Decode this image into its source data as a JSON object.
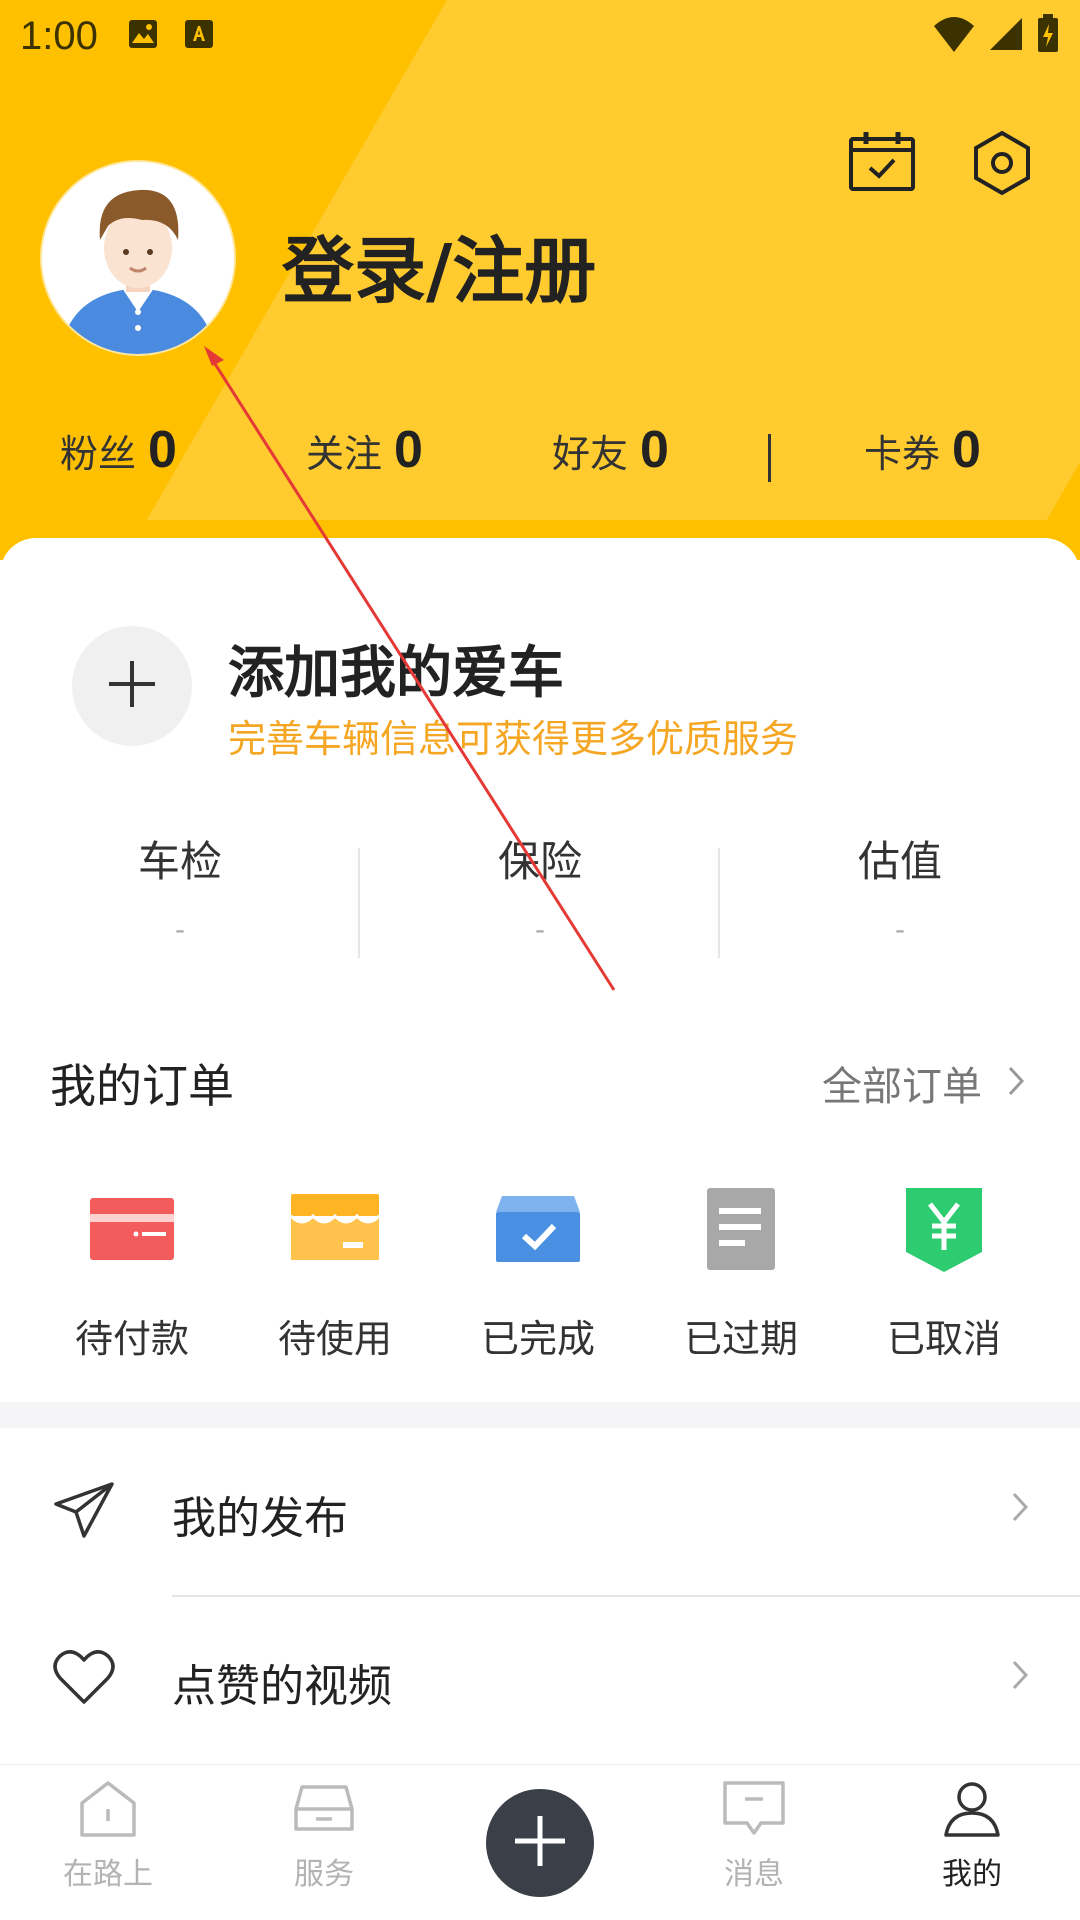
{
  "status_bar": {
    "time": "1:00"
  },
  "header": {
    "login_title": "登录/注册",
    "stats": [
      {
        "label": "粉丝",
        "value": "0"
      },
      {
        "label": "关注",
        "value": "0"
      },
      {
        "label": "好友",
        "value": "0"
      },
      {
        "label": "卡券",
        "value": "0"
      }
    ]
  },
  "add_car": {
    "title": "添加我的爱车",
    "subtitle": "完善车辆信息可获得更多优质服务"
  },
  "car_info": [
    {
      "label": "车检",
      "value": "-"
    },
    {
      "label": "保险",
      "value": "-"
    },
    {
      "label": "估值",
      "value": "-"
    }
  ],
  "orders": {
    "title": "我的订单",
    "all_label": "全部订单",
    "items": [
      {
        "label": "待付款",
        "icon": "wallet-card-icon",
        "color": "#F25C5C"
      },
      {
        "label": "待使用",
        "icon": "store-icon",
        "color": "#FFB424"
      },
      {
        "label": "已完成",
        "icon": "box-check-icon",
        "color": "#4A90E2"
      },
      {
        "label": "已过期",
        "icon": "document-icon",
        "color": "#A8A8A8"
      },
      {
        "label": "已取消",
        "icon": "yen-shield-icon",
        "color": "#2ECC71"
      }
    ]
  },
  "menu": [
    {
      "label": "我的发布",
      "icon": "paper-plane-icon"
    },
    {
      "label": "点赞的视频",
      "icon": "heart-icon"
    }
  ],
  "bottom_nav": [
    {
      "label": "在路上",
      "icon": "home-icon"
    },
    {
      "label": "服务",
      "icon": "car-icon"
    },
    {
      "label": "消息",
      "icon": "message-icon"
    },
    {
      "label": "我的",
      "icon": "person-icon",
      "active": true
    }
  ],
  "colors": {
    "header_bg": "#FFC000",
    "accent_orange": "#F5A623",
    "fab_bg": "#3A3F48",
    "annotation_red": "#E53935"
  }
}
